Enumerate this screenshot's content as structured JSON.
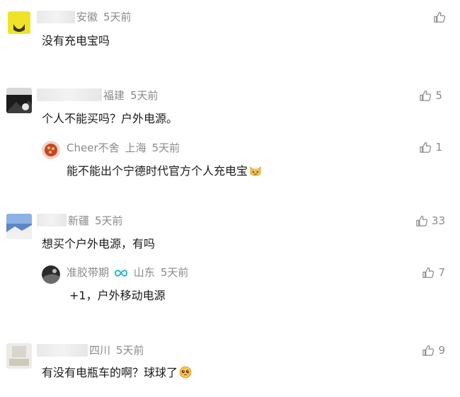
{
  "comments": [
    {
      "location": "安徽",
      "time": "5天前",
      "text": "没有充电宝吗",
      "likes": ""
    },
    {
      "location": "福建",
      "time": "5天前",
      "text": "个人不能买吗？户外电源。",
      "likes": "5",
      "reply": {
        "name": "Cheer不舍",
        "location": "上海",
        "time": "5天前",
        "text": "能不能出个宁德时代官方个人充电宝",
        "likes": "1"
      }
    },
    {
      "location": "新疆",
      "time": "5天前",
      "text": "想买个户外电源，有吗",
      "likes": "33",
      "reply": {
        "name": "准胶带期",
        "location": "山东",
        "time": "5天前",
        "text": "+1，户外移动电源",
        "likes": "7"
      }
    },
    {
      "location": "四川",
      "time": "5天前",
      "text": "有没有电瓶车的啊？球球了",
      "likes": "9"
    }
  ],
  "icons": {
    "like": "thumbs-up-icon",
    "vip": "infinity-badge-icon",
    "emoji_cat": "cat-emoji-icon",
    "emoji_pleading": "pleading-face-emoji-icon"
  },
  "colors": {
    "meta": "#8a8a8a",
    "text": "#1a1a1a",
    "vip_badge": "#2bb3d6"
  }
}
